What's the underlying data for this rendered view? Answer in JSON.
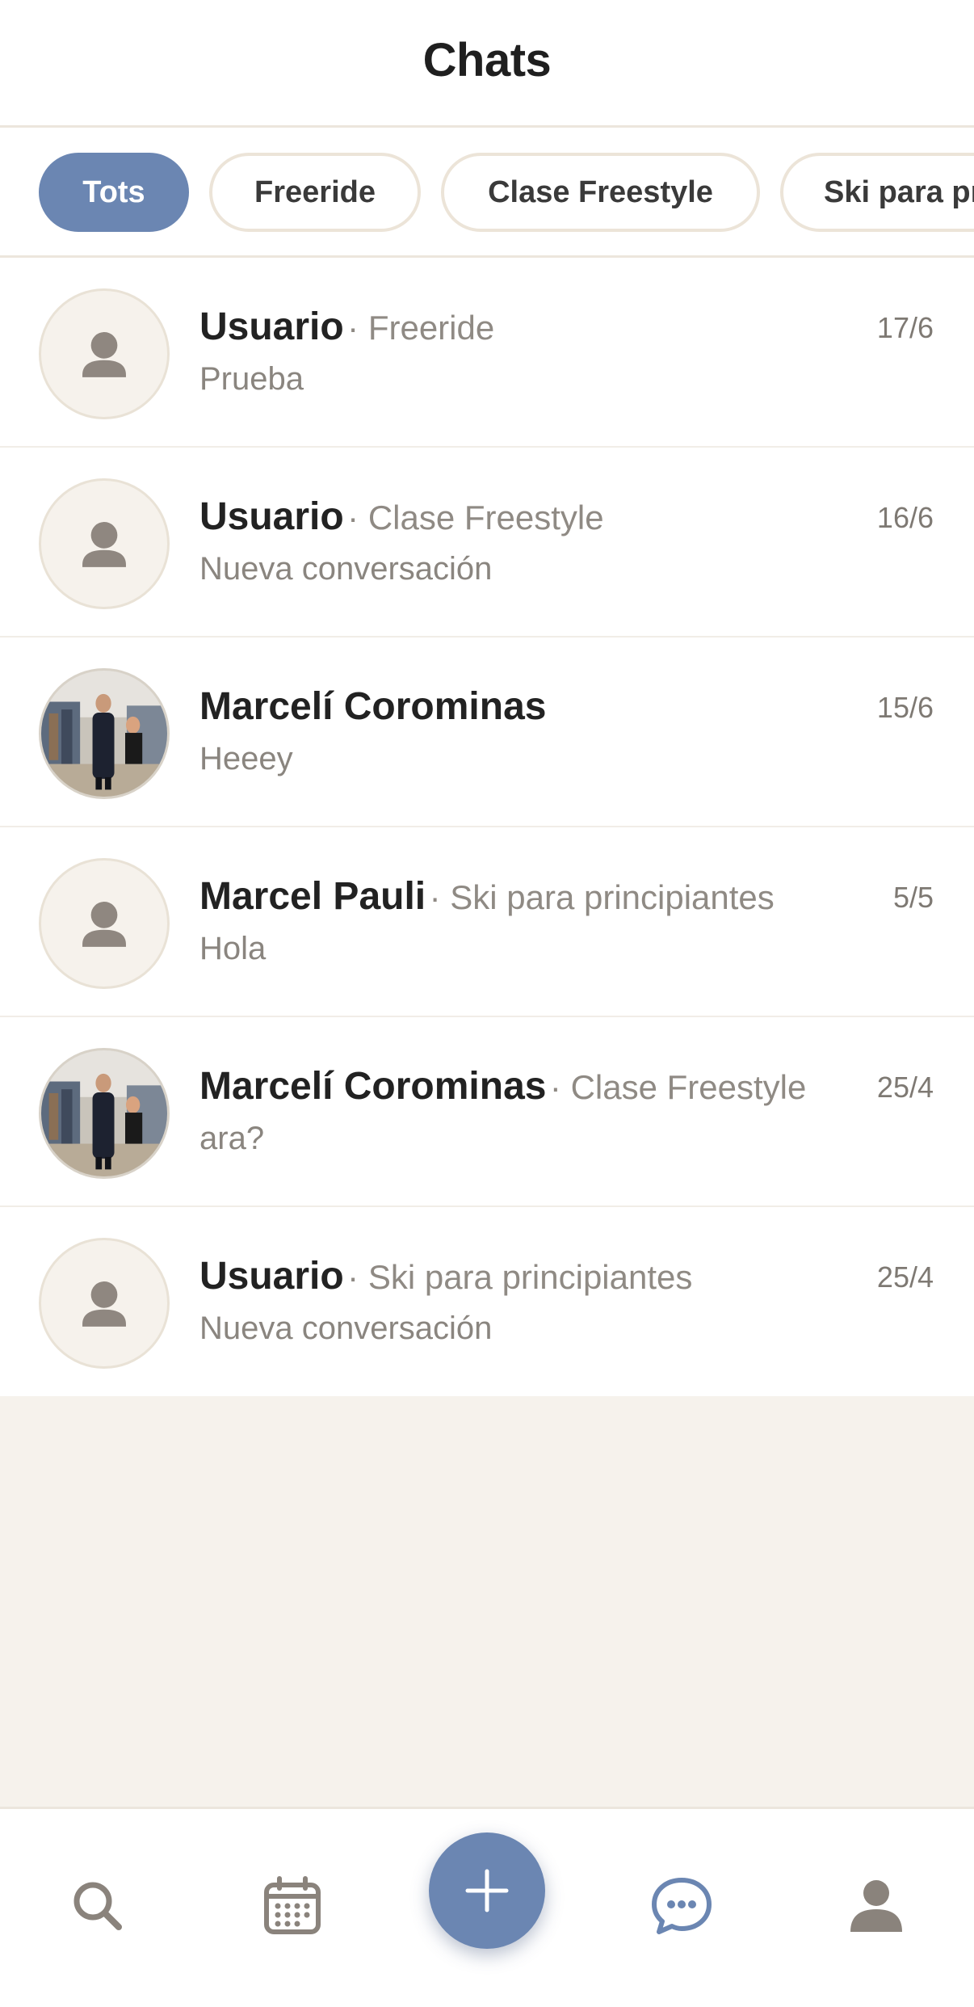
{
  "header": {
    "title": "Chats"
  },
  "filters": [
    {
      "label": "Tots",
      "active": true
    },
    {
      "label": "Freeride",
      "active": false
    },
    {
      "label": "Clase Freestyle",
      "active": false
    },
    {
      "label": "Ski para principiantes",
      "active": false
    }
  ],
  "chats": [
    {
      "name": "Usuario",
      "context": "Freeride",
      "preview": "Prueba",
      "date": "17/6",
      "avatar": "default-avatar-icon"
    },
    {
      "name": "Usuario",
      "context": "Clase Freestyle",
      "preview": "Nueva conversación",
      "date": "16/6",
      "avatar": "default-avatar-icon"
    },
    {
      "name": "Marcelí Corominas",
      "context": "",
      "preview": "Heeey",
      "date": "15/6",
      "avatar": "photo"
    },
    {
      "name": "Marcel Pauli",
      "context": "Ski para principiantes",
      "preview": "Hola",
      "date": "5/5",
      "avatar": "default-avatar-icon"
    },
    {
      "name": "Marcelí Corominas",
      "context": "Clase Freestyle",
      "preview": "ara?",
      "date": "25/4",
      "avatar": "photo"
    },
    {
      "name": "Usuario",
      "context": "Ski para principiantes",
      "preview": "Nueva conversación",
      "date": "25/4",
      "avatar": "default-avatar-icon"
    }
  ],
  "nav": {
    "items": [
      "search-icon",
      "calendar-icon",
      "plus-icon",
      "chat-icon",
      "profile-icon"
    ],
    "active": "chat-icon"
  },
  "colors": {
    "accent": "#6b86b2",
    "background": "#f6f2ec",
    "muted_text": "#8f8a84",
    "chip_border": "#ece4d8"
  }
}
